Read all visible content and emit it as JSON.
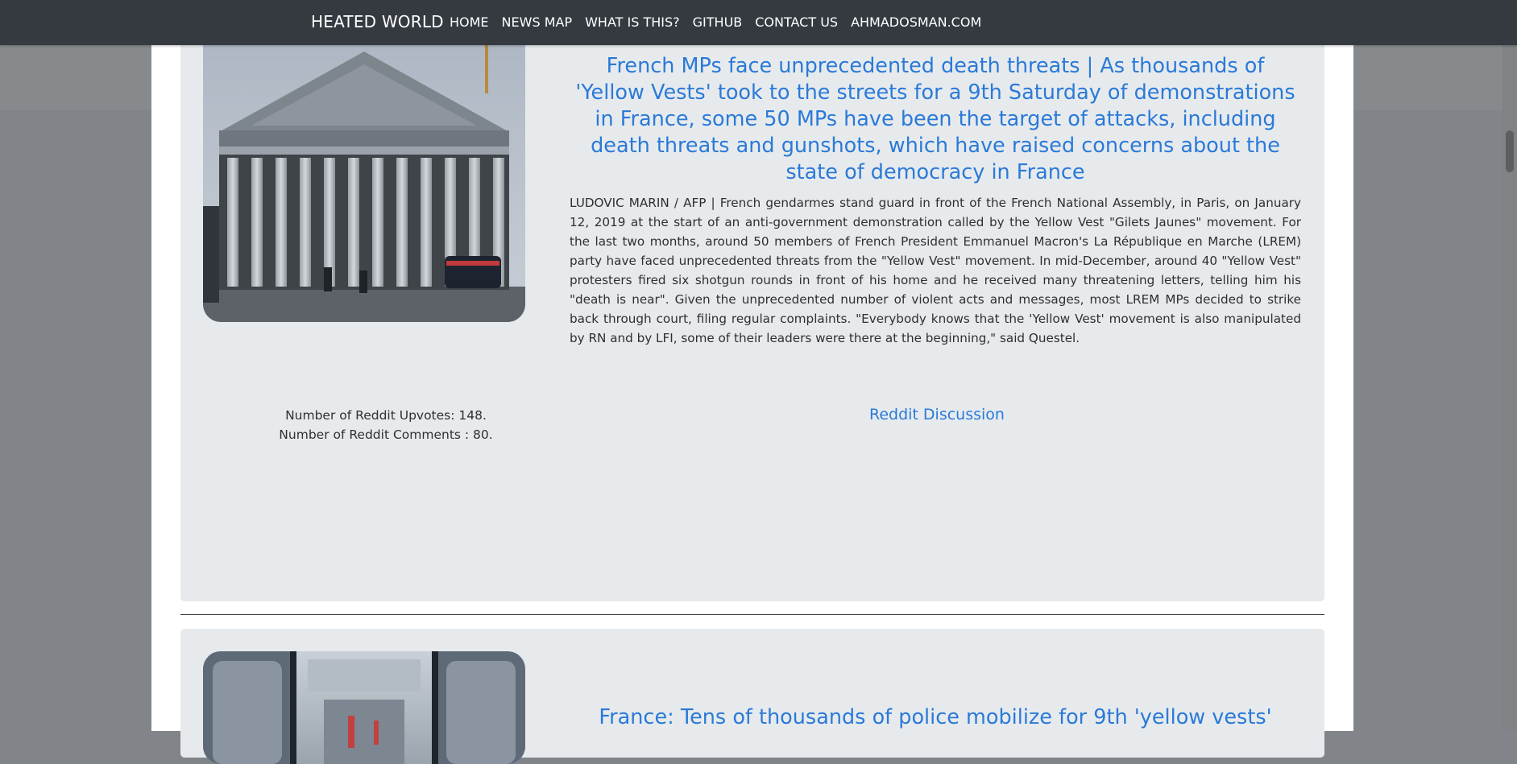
{
  "navbar": {
    "brand": "HEATED WORLD",
    "links": [
      "HOME",
      "NEWS MAP",
      "WHAT IS THIS?",
      "GITHUB",
      "CONTACT US",
      "AHMADOSMAN.COM"
    ]
  },
  "articles": [
    {
      "image_icon": "photo-icon",
      "title": "French MPs face unprecedented death threats | As thousands of 'Yellow Vests' took to the streets for a 9th Saturday of demonstrations in France, some 50 MPs have been the target of attacks, including death threats and gunshots, which have raised concerns about the state of democracy in France",
      "body": "LUDOVIC MARIN / AFP | French gendarmes stand guard in front of the French National Assembly, in Paris, on January 12, 2019 at the start of an anti-government demonstration called by the Yellow Vest \"Gilets Jaunes\" movement. For the last two months, around 50 members of French President Emmanuel Macron's La République en Marche (LREM) party have faced unprecedented threats from the \"Yellow Vest\" movement. In mid-December, around 40 \"Yellow Vest\" protesters fired six shotgun rounds in front of his home and he received many threatening letters, telling him his \"death is near\". Given the unprecedented number of violent acts and messages, most LREM MPs decided to strike back through court, filing regular complaints. \"Everybody knows that the 'Yellow Vest' movement is also manipulated by RN and by LFI, some of their leaders were there at the beginning,\" said Questel.",
      "upvotes": "Number of Reddit Upvotes: 148.",
      "comments": "Number of Reddit Comments : 80.",
      "discussion_label": "Reddit Discussion"
    },
    {
      "image_icon": "photo-icon",
      "title": "France: Tens of thousands of police mobilize for 9th 'yellow vests'"
    }
  ],
  "colors": {
    "navbar_bg": "#343a40",
    "link": "#2a7ad8",
    "card_bg": "#e7eaed",
    "overlay": "#818589"
  }
}
